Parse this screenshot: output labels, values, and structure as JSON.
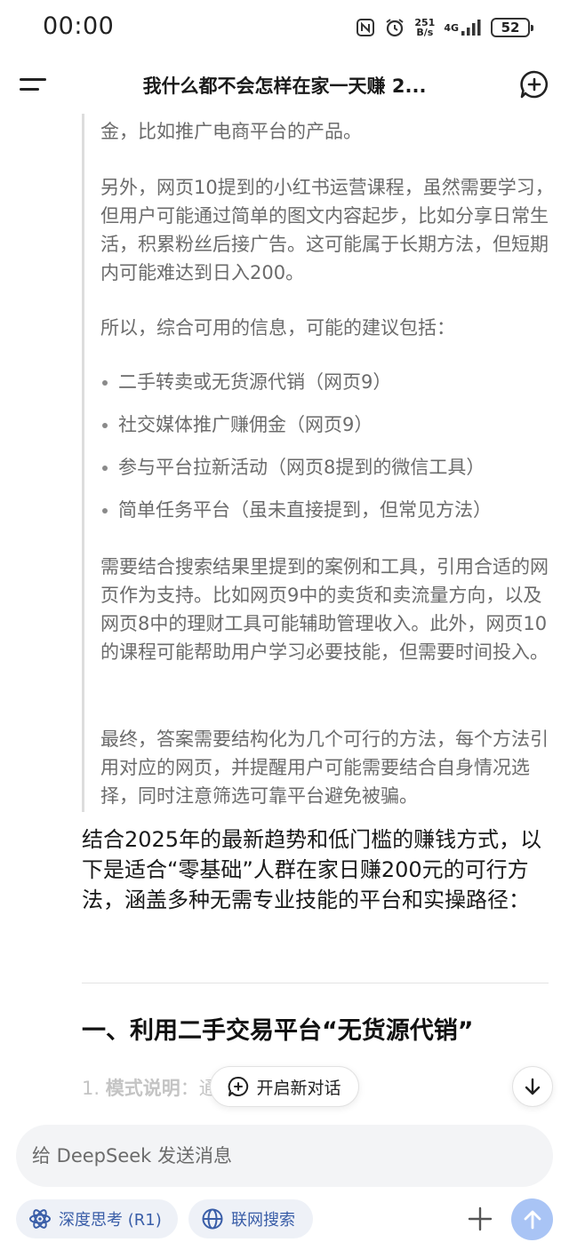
{
  "status_bar": {
    "time": "00:00",
    "net_speed_value": "251",
    "net_speed_unit": "B/s",
    "network_gen": "4G",
    "battery": "52"
  },
  "header": {
    "title": "我什么都不会怎样在家一天赚 2..."
  },
  "thinking": {
    "paragraphs": [
      "金，比如推广电商平台的产品。",
      "另外，网页10提到的小红书运营课程，虽然需要学习，但用户可能通过简单的图文内容起步，比如分享日常生活，积累粉丝后接广告。这可能属于长期方法，但短期内可能难达到日入200。",
      "所以，综合可用的信息，可能的建议包括：",
      "需要结合搜索结果里提到的案例和工具，引用合适的网页作为支持。比如网页9中的卖货和卖流量方向，以及网页8中的理财工具可能辅助管理收入。此外，网页10的课程可能帮助用户学习必要技能，但需要时间投入。",
      "最终，答案需要结构化为几个可行的方法，每个方法引用对应的网页，并提醒用户可能需要结合自身情况选择，同时注意筛选可靠平台避免被骗。"
    ],
    "bullets": [
      "二手转卖或无货源代销（网页9）",
      "社交媒体推广赚佣金（网页9）",
      "参与平台拉新活动（网页8提到的微信工具）",
      "简单任务平台（虽未直接提到，但常见方法）"
    ]
  },
  "answer": {
    "intro": "结合2025年的最新趋势和低门槛的赚钱方式，以下是适合“零基础”人群在家日赚200元的可行方法，涵盖多种无需专业技能的平台和实操路径：",
    "section1_title": "一、利用二手交易平台“无货源代销”",
    "item1_number": "1.",
    "item1_label": "模式说明",
    "item1_text": "：通过搬运其他平台"
  },
  "floating": {
    "new_chat_label": "开启新对话"
  },
  "input": {
    "placeholder": "给 DeepSeek 发送消息"
  },
  "chips": {
    "deep_think": "深度思考 (R1)",
    "web_search": "联网搜索"
  },
  "colors": {
    "accent": "#3a5ea8",
    "send_button": "#a9c4f5",
    "chip_bg": "#eef1f7",
    "thinking_text": "#6b6b6b"
  }
}
